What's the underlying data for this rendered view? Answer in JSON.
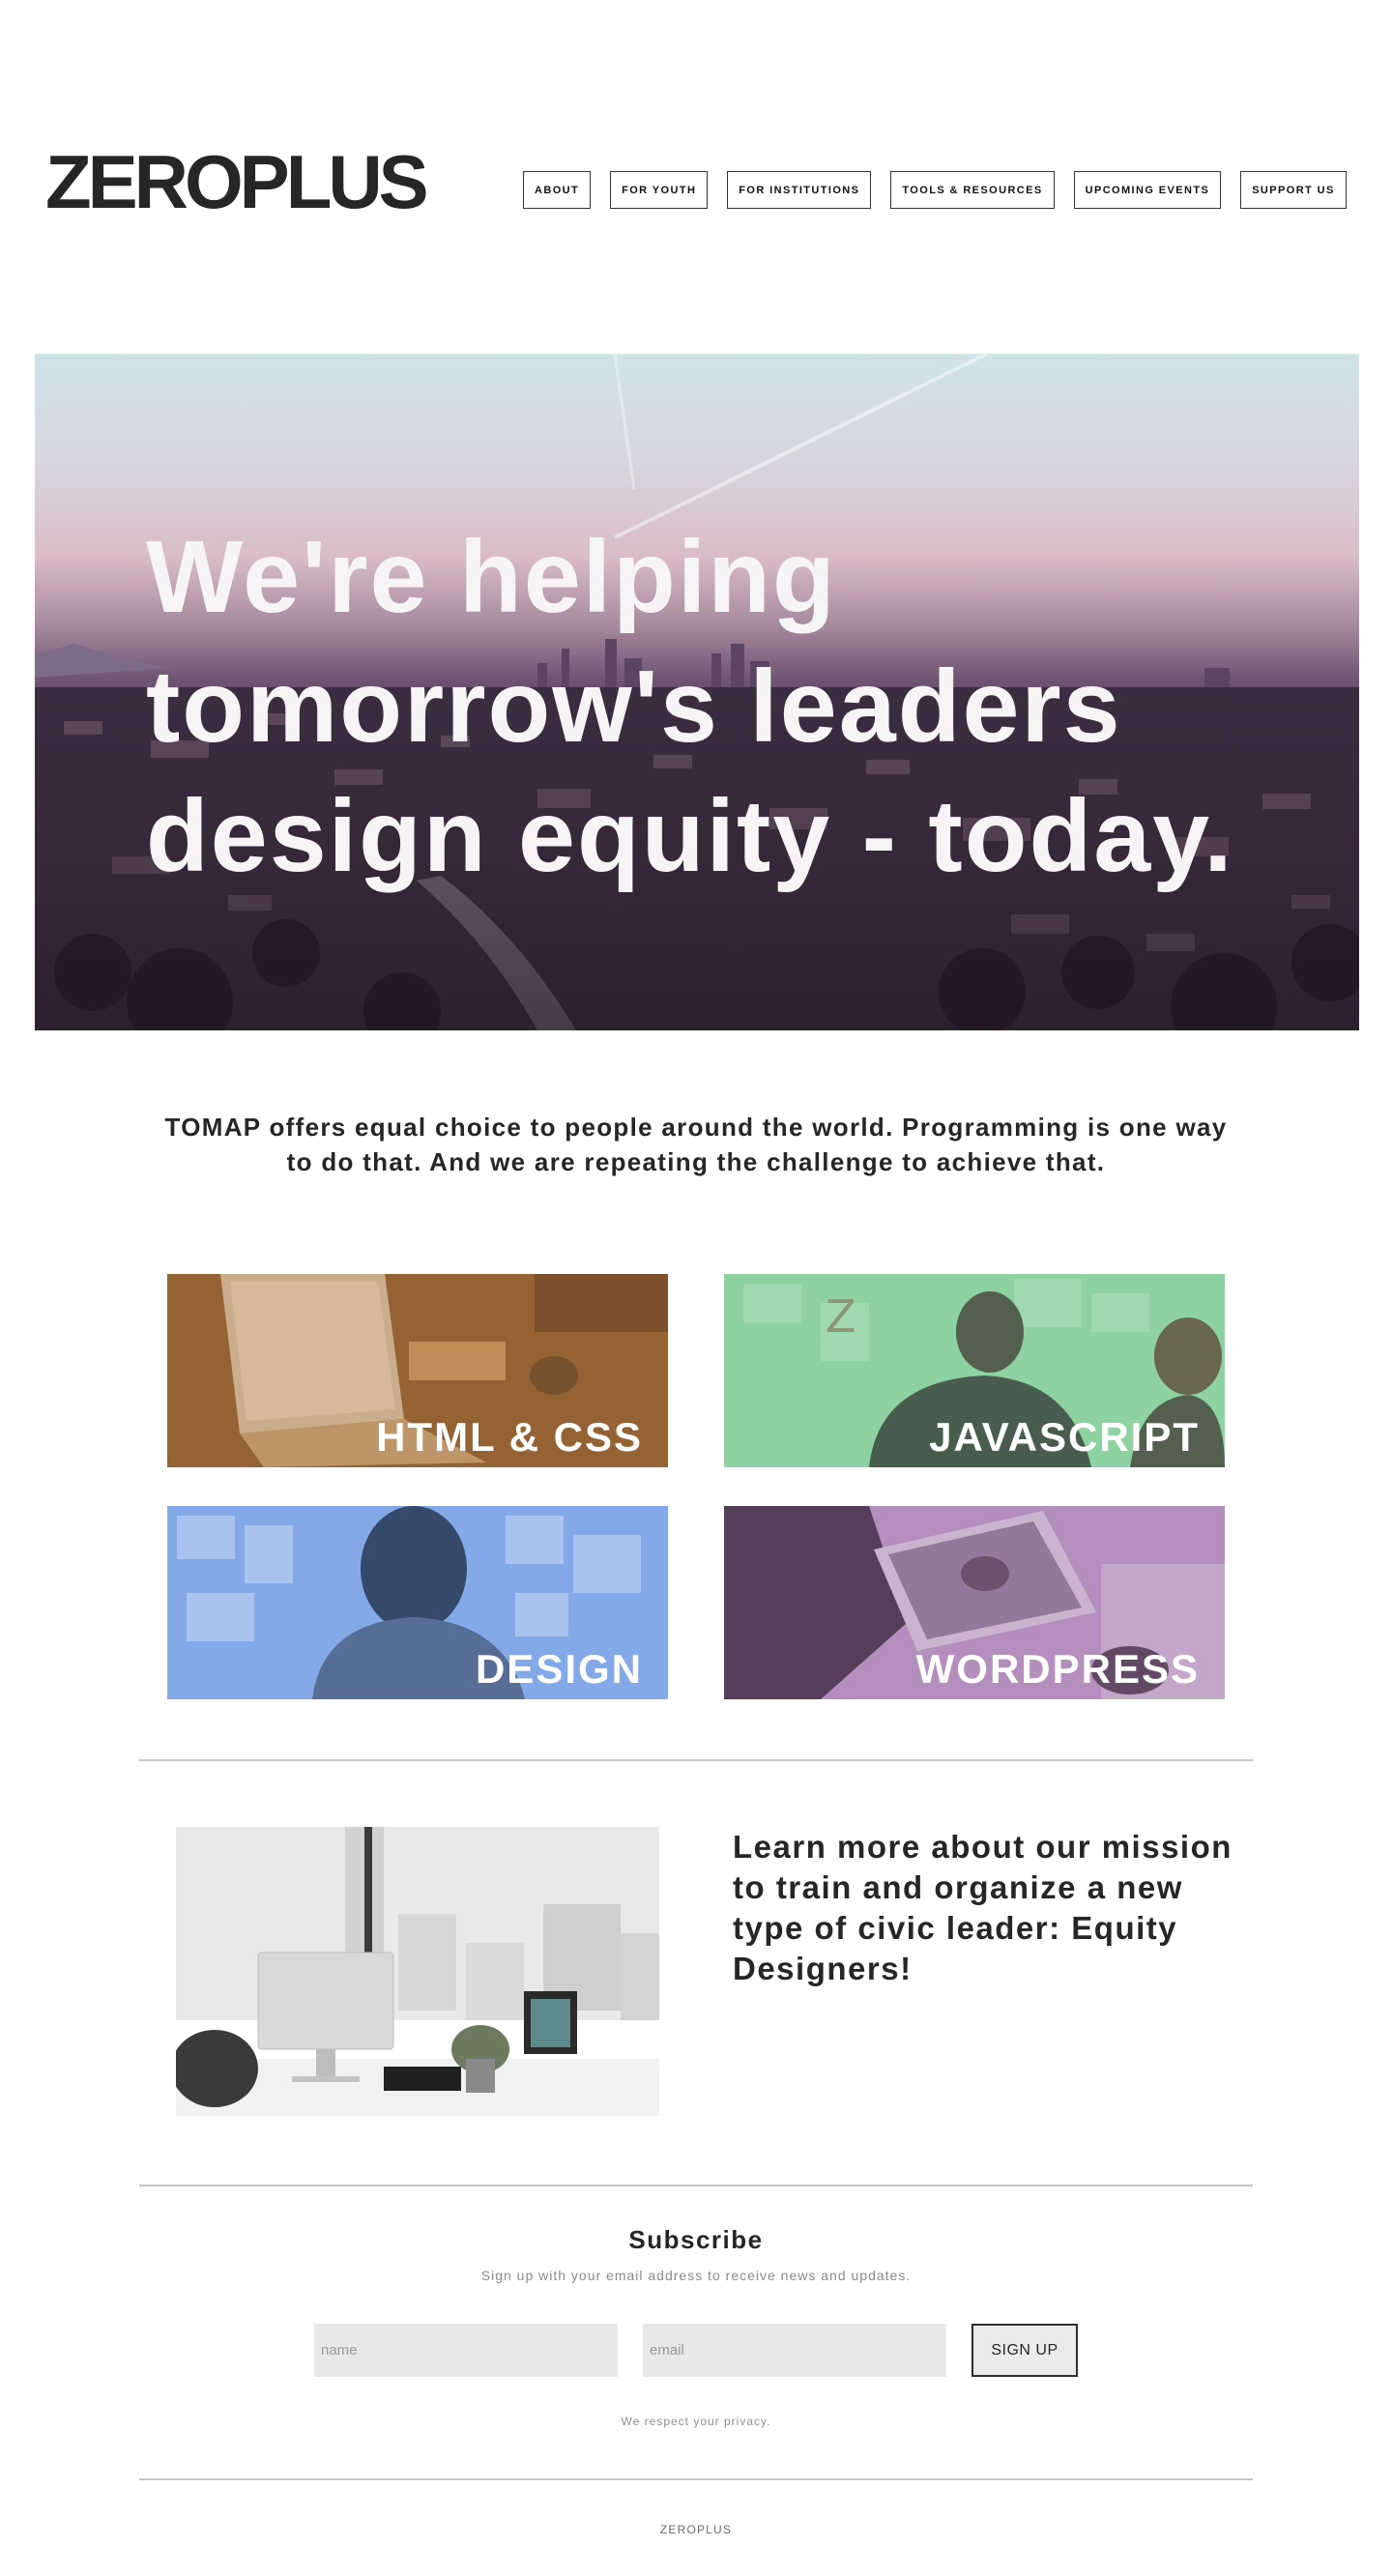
{
  "header": {
    "logo": "ZEROPLUS",
    "nav": [
      "ABOUT",
      "FOR YOUTH",
      "FOR INSTITUTIONS",
      "TOOLS & RESOURCES",
      "UPCOMING EVENTS",
      "SUPPORT US"
    ]
  },
  "hero": {
    "lines": [
      "We're helping",
      "tomorrow's leaders",
      "design equity - today."
    ]
  },
  "intro": {
    "text": "TOMAP offers equal choice to people around the world. Programming is one way to do that. And we are repeating the challenge to achieve that."
  },
  "courses": [
    {
      "label": "HTML & CSS",
      "tint": "#a0662e"
    },
    {
      "label": "JAVASCRIPT",
      "tint": "#8ed4a2"
    },
    {
      "label": "DESIGN",
      "tint": "#7fa6e6"
    },
    {
      "label": "WORDPRESS",
      "tint": "#a77bb0"
    }
  ],
  "mission": {
    "text": "Learn more about our mission to train and organize a new type of civic leader: Equity Designers!"
  },
  "subscribe": {
    "title": "Subscribe",
    "description": "Sign up with your email address to receive news and updates.",
    "name_placeholder": "name",
    "email_placeholder": "email",
    "button": "SIGN UP",
    "privacy": "We respect your privacy."
  },
  "footer": {
    "text": "ZEROPLUS"
  }
}
